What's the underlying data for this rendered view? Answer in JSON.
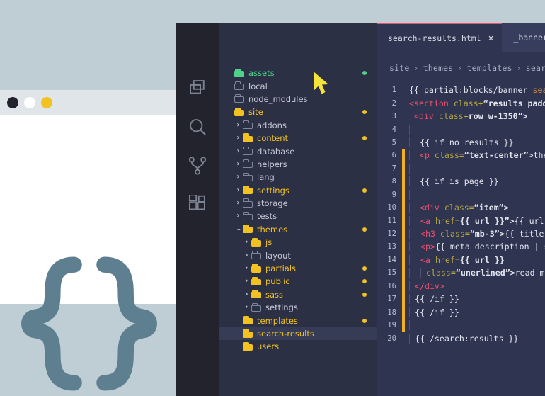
{
  "browser": {
    "traffic_lights": [
      "close",
      "minimize",
      "maximize"
    ],
    "logo": "curly-braces"
  },
  "activity_bar": {
    "icons": [
      {
        "name": "files-icon",
        "label": "Explorer"
      },
      {
        "name": "search-icon",
        "label": "Search"
      },
      {
        "name": "source-control-icon",
        "label": "Source Control"
      },
      {
        "name": "extensions-icon",
        "label": "Extensions"
      }
    ]
  },
  "explorer": {
    "items": [
      {
        "label": "assets",
        "indent": 0,
        "chevron": "",
        "folder": "filled",
        "color": "green",
        "dot": "green"
      },
      {
        "label": "local",
        "indent": 0,
        "chevron": "",
        "folder": "open",
        "color": "grey",
        "dot": ""
      },
      {
        "label": "node_modules",
        "indent": 0,
        "chevron": "",
        "folder": "open",
        "color": "grey",
        "dot": ""
      },
      {
        "label": "site",
        "indent": 0,
        "chevron": "",
        "folder": "filled",
        "color": "yellow",
        "dot": "yellow"
      },
      {
        "label": "addons",
        "indent": 1,
        "chevron": "›",
        "folder": "open",
        "color": "grey",
        "dot": ""
      },
      {
        "label": "content",
        "indent": 1,
        "chevron": "›",
        "folder": "filled",
        "color": "yellow",
        "dot": "yellow"
      },
      {
        "label": "database",
        "indent": 1,
        "chevron": "›",
        "folder": "open",
        "color": "grey",
        "dot": ""
      },
      {
        "label": "helpers",
        "indent": 1,
        "chevron": "›",
        "folder": "open",
        "color": "grey",
        "dot": ""
      },
      {
        "label": "lang",
        "indent": 1,
        "chevron": "›",
        "folder": "open",
        "color": "grey",
        "dot": ""
      },
      {
        "label": "settings",
        "indent": 1,
        "chevron": "›",
        "folder": "filled",
        "color": "yellow",
        "dot": "yellow"
      },
      {
        "label": "storage",
        "indent": 1,
        "chevron": "›",
        "folder": "open",
        "color": "grey",
        "dot": ""
      },
      {
        "label": "tests",
        "indent": 1,
        "chevron": "›",
        "folder": "open",
        "color": "grey",
        "dot": ""
      },
      {
        "label": "themes",
        "indent": 1,
        "chevron": "⌄",
        "folder": "filled",
        "color": "yellow",
        "dot": "yellow"
      },
      {
        "label": "js",
        "indent": 2,
        "chevron": "›",
        "folder": "filled",
        "color": "yellow",
        "dot": ""
      },
      {
        "label": "layout",
        "indent": 2,
        "chevron": "›",
        "folder": "open",
        "color": "grey",
        "dot": ""
      },
      {
        "label": "partials",
        "indent": 2,
        "chevron": "›",
        "folder": "filled",
        "color": "yellow",
        "dot": "yellow"
      },
      {
        "label": "public",
        "indent": 2,
        "chevron": "›",
        "folder": "filled",
        "color": "yellow",
        "dot": "yellow"
      },
      {
        "label": "sass",
        "indent": 2,
        "chevron": "›",
        "folder": "filled",
        "color": "yellow",
        "dot": "yellow"
      },
      {
        "label": "settings",
        "indent": 2,
        "chevron": "›",
        "folder": "open",
        "color": "grey",
        "dot": ""
      },
      {
        "label": "templates",
        "indent": 1,
        "chevron": "",
        "folder": "filled",
        "color": "yellow",
        "dot": "yellow"
      },
      {
        "label": "search-results",
        "indent": 1,
        "chevron": "",
        "folder": "filled",
        "color": "yellow",
        "dot": "",
        "selected": true
      },
      {
        "label": "users",
        "indent": 1,
        "chevron": "",
        "folder": "filled",
        "color": "yellow",
        "dot": ""
      }
    ]
  },
  "editor": {
    "tabs": [
      {
        "label": "search-results.html",
        "close": "×",
        "active": true
      },
      {
        "label": "_banner.s",
        "close": "",
        "active": false
      }
    ],
    "breadcrumb": [
      "site",
      "themes",
      "templates",
      "search-re"
    ],
    "breadcrumb_separator": "›",
    "accent_color": "#e8506e",
    "change_indicator_color": "#f2b01e",
    "lines": [
      {
        "n": "1",
        "changed": false,
        "guides": 0
      },
      {
        "n": "2",
        "changed": false,
        "guides": 0
      },
      {
        "n": "3",
        "changed": false,
        "guides": 0
      },
      {
        "n": "4",
        "changed": false,
        "guides": 1
      },
      {
        "n": "5",
        "changed": false,
        "guides": 1
      },
      {
        "n": "6",
        "changed": true,
        "guides": 1
      },
      {
        "n": "7",
        "changed": true,
        "guides": 1
      },
      {
        "n": "8",
        "changed": true,
        "guides": 1
      },
      {
        "n": "9",
        "changed": true,
        "guides": 1
      },
      {
        "n": "10",
        "changed": true,
        "guides": 1
      },
      {
        "n": "11",
        "changed": true,
        "guides": 2
      },
      {
        "n": "12",
        "changed": true,
        "guides": 2
      },
      {
        "n": "13",
        "changed": true,
        "guides": 2
      },
      {
        "n": "14",
        "changed": true,
        "guides": 2
      },
      {
        "n": "15",
        "changed": true,
        "guides": 3
      },
      {
        "n": "16",
        "changed": true,
        "guides": 1
      },
      {
        "n": "17",
        "changed": true,
        "guides": 1
      },
      {
        "n": "18",
        "changed": true,
        "guides": 1
      },
      {
        "n": "19",
        "changed": true,
        "guides": 1
      },
      {
        "n": "20",
        "changed": false,
        "guides": 1
      }
    ],
    "code": [
      [
        {
          "t": "{{ partial:blocks/banner ",
          "c": "t-plain"
        },
        {
          "t": "search=",
          "c": "t-orange"
        }
      ],
      [
        {
          "t": "<section ",
          "c": "t-tag"
        },
        {
          "t": "class+",
          "c": "t-attr"
        },
        {
          "t": "“results padding-",
          "c": "t-str"
        }
      ],
      [
        {
          "t": " <div ",
          "c": "t-tag"
        },
        {
          "t": "class+",
          "c": "t-attr"
        },
        {
          "t": "row w-1350”>",
          "c": "t-str"
        }
      ],
      [],
      [
        {
          "t": " {{ if no_results }}",
          "c": "t-plain"
        }
      ],
      [
        {
          "t": " <p ",
          "c": "t-tag"
        },
        {
          "t": "class=",
          "c": "t-attr"
        },
        {
          "t": "“text-center”",
          "c": "t-str"
        },
        {
          "t": ">there a",
          "c": "t-plain"
        }
      ],
      [],
      [
        {
          "t": " {{ if is_page }}",
          "c": "t-plain"
        }
      ],
      [],
      [
        {
          "t": " <div ",
          "c": "t-tag"
        },
        {
          "t": "class=",
          "c": "t-attr"
        },
        {
          "t": "“item”>",
          "c": "t-str"
        }
      ],
      [
        {
          "t": "<a ",
          "c": "t-tag"
        },
        {
          "t": "href=",
          "c": "t-attr"
        },
        {
          "t": "{{ url }}”>",
          "c": "t-str"
        },
        {
          "t": "{{ url }}<",
          "c": "t-plain"
        }
      ],
      [
        {
          "t": "<h3 ",
          "c": "t-tag"
        },
        {
          "t": "class=",
          "c": "t-attr"
        },
        {
          "t": "“mb-3”>",
          "c": "t-str"
        },
        {
          "t": "{{ title }}<",
          "c": "t-plain"
        }
      ],
      [
        {
          "t": "<p>",
          "c": "t-tag"
        },
        {
          "t": "{{ meta_description | safe",
          "c": "t-plain"
        }
      ],
      [
        {
          "t": "<a ",
          "c": "t-tag"
        },
        {
          "t": "href=",
          "c": "t-attr"
        },
        {
          "t": "{{ url }}",
          "c": "t-str"
        }
      ],
      [
        {
          "t": "class=",
          "c": "t-attr"
        },
        {
          "t": "“unerlined”>",
          "c": "t-str"
        },
        {
          "t": "read more",
          "c": "t-plain"
        }
      ],
      [
        {
          "t": "</div>",
          "c": "t-tag"
        }
      ],
      [
        {
          "t": "{{ /if }}",
          "c": "t-plain"
        }
      ],
      [
        {
          "t": "{{ /if }}",
          "c": "t-plain"
        }
      ],
      [],
      [
        {
          "t": "{{ /search:results }}",
          "c": "t-plain"
        }
      ]
    ]
  },
  "cursor": {
    "name": "mouse-pointer",
    "color": "#f5e23b"
  }
}
